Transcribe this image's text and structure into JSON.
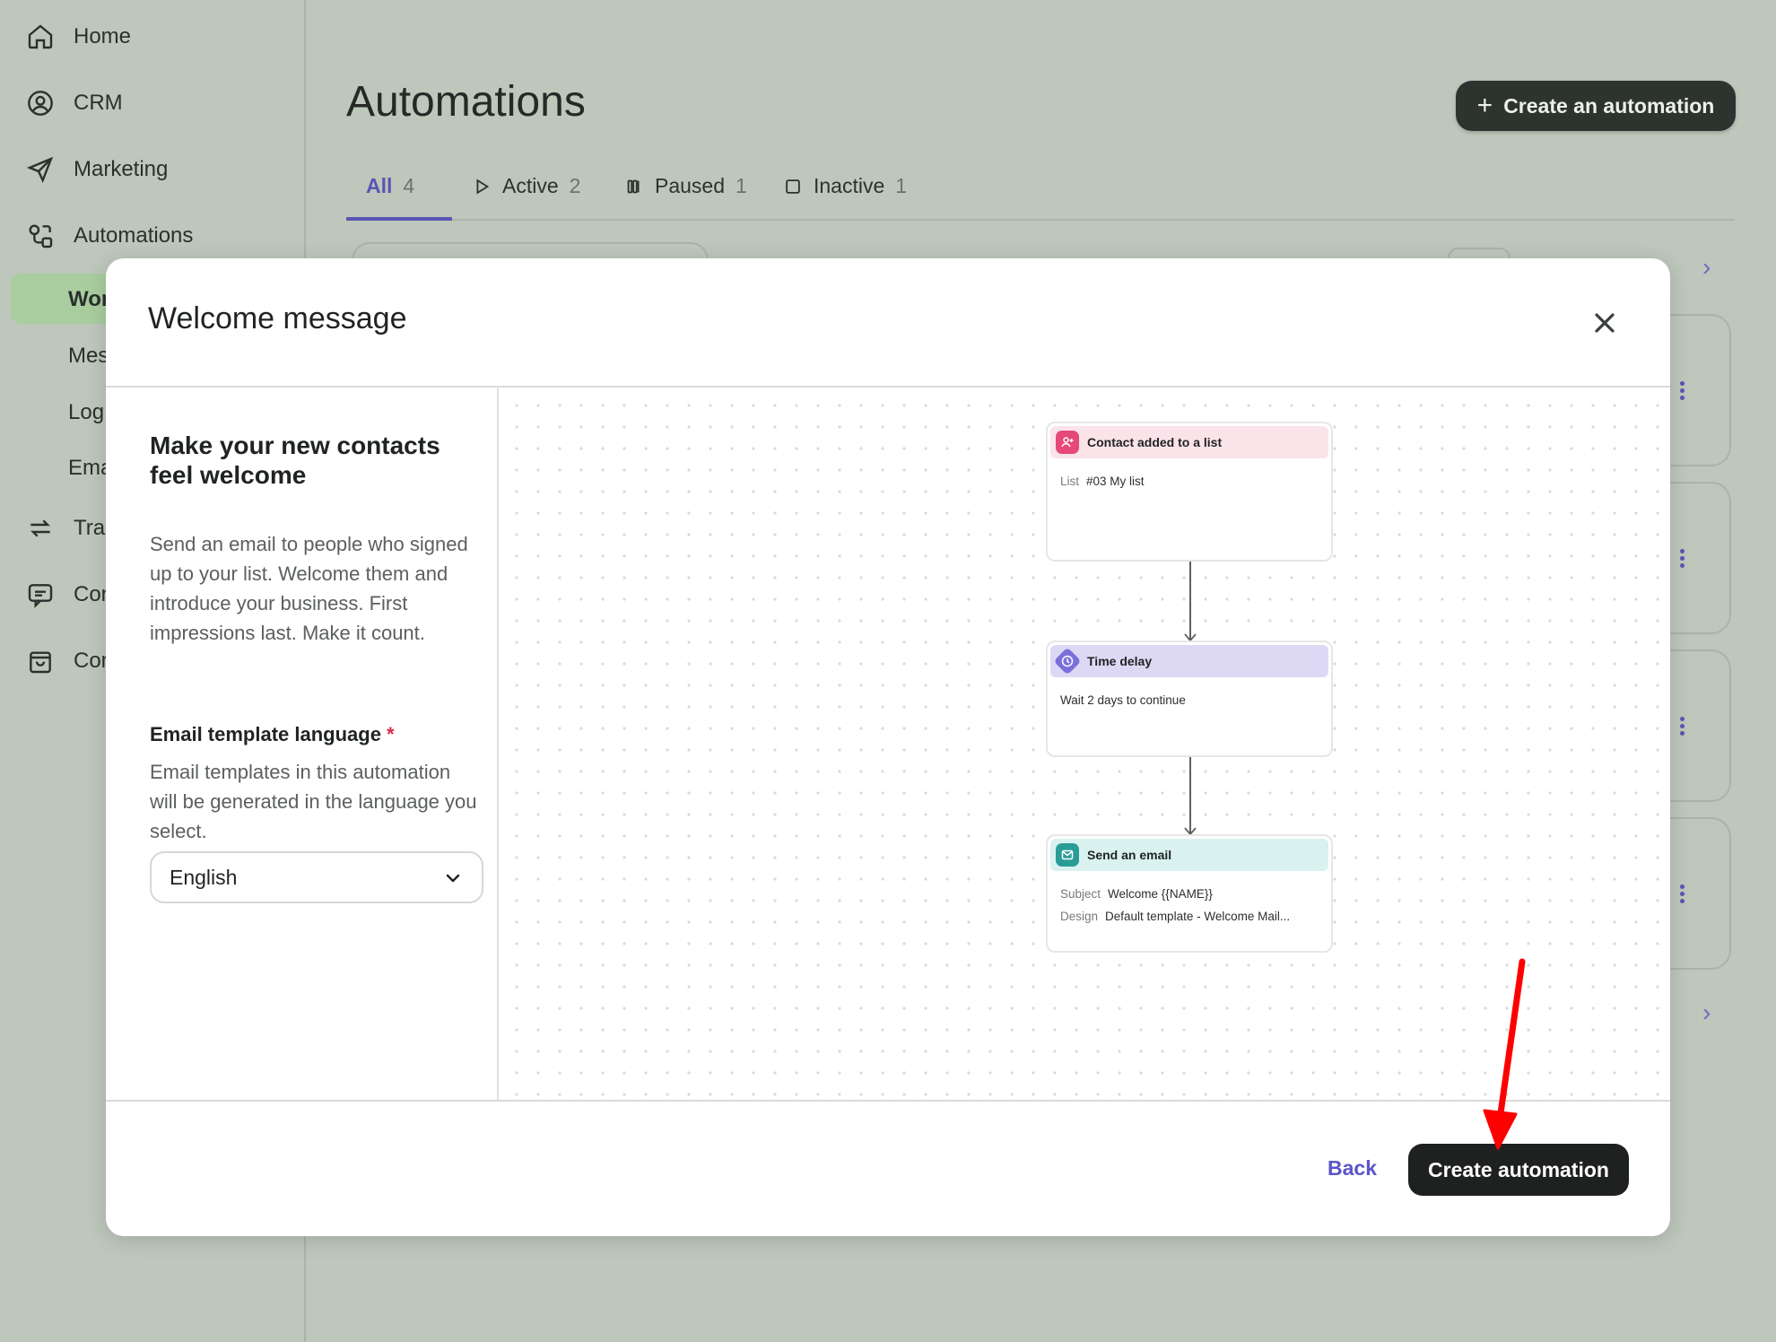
{
  "sidebar": {
    "items": [
      {
        "label": "Home",
        "icon": "home-icon"
      },
      {
        "label": "CRM",
        "icon": "user-circle-icon"
      },
      {
        "label": "Marketing",
        "icon": "send-icon"
      },
      {
        "label": "Automations",
        "icon": "automation-icon"
      }
    ],
    "sub_items": [
      "Wor",
      "Mes",
      "Log",
      "Ema"
    ],
    "more_items": [
      {
        "label": "Trar",
        "icon": "transfer-icon"
      },
      {
        "label": "Con",
        "icon": "chat-icon"
      },
      {
        "label": "Com",
        "icon": "bag-icon"
      }
    ]
  },
  "main": {
    "title": "Automations",
    "create_button": "Create an automation",
    "tabs": [
      {
        "label": "All",
        "count": "4"
      },
      {
        "label": "Active",
        "count": "2"
      },
      {
        "label": "Paused",
        "count": "1"
      },
      {
        "label": "Inactive",
        "count": "1"
      }
    ]
  },
  "modal": {
    "title": "Welcome message",
    "heading": "Make your new contacts feel welcome",
    "description": "Send an email to people who signed up to your list. Welcome them and introduce your business. First impressions last. Make it count.",
    "language_label": "Email template language",
    "required_mark": "*",
    "language_help": "Email templates in this automation will be generated in the language you select.",
    "language_value": "English",
    "back_label": "Back",
    "create_label": "Create automation",
    "flow": {
      "trigger": {
        "title": "Contact added to a list",
        "key": "List",
        "value": "#03 My list"
      },
      "delay": {
        "title": "Time delay",
        "text": "Wait 2 days to continue"
      },
      "email": {
        "title": "Send an email",
        "subject_key": "Subject",
        "subject_value": "Welcome {{NAME}}",
        "design_key": "Design",
        "design_value": "Default template - Welcome Mail..."
      }
    }
  },
  "colors": {
    "accent": "#5a55b3",
    "background": "#bdc7bb",
    "annotation_arrow": "#ff0000"
  }
}
